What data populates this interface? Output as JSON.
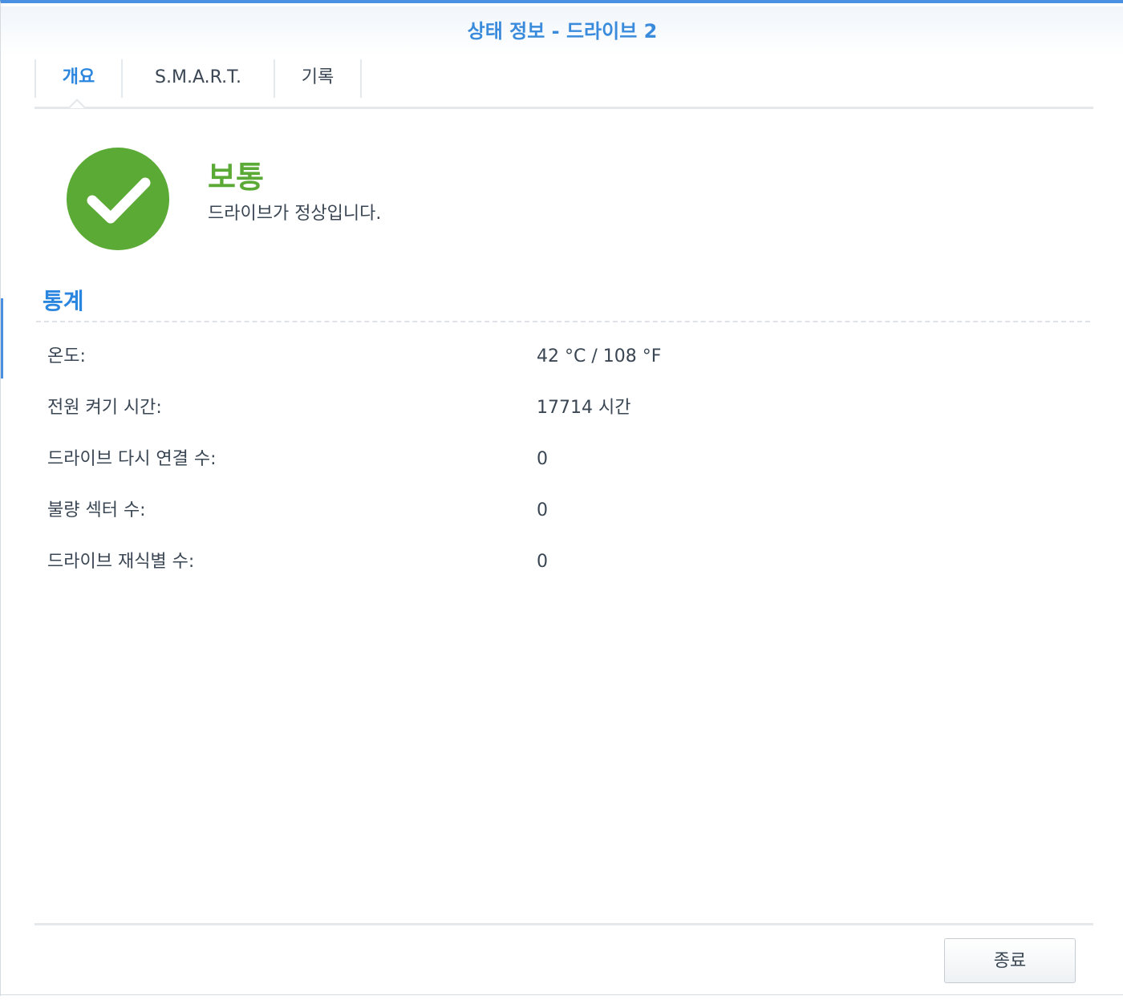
{
  "window": {
    "title": "상태 정보 - 드라이브 2"
  },
  "tabs": [
    {
      "label": "개요",
      "active": true
    },
    {
      "label": "S.M.A.R.T.",
      "active": false
    },
    {
      "label": "기록",
      "active": false
    }
  ],
  "status": {
    "icon": "check-circle-icon",
    "color": "#5aaa35",
    "title": "보통",
    "description": "드라이브가 정상입니다."
  },
  "statistics": {
    "section_title": "통계",
    "rows": [
      {
        "label": "온도:",
        "value": "42 °C / 108 °F"
      },
      {
        "label": "전원 켜기 시간:",
        "value": "17714 시간"
      },
      {
        "label": "드라이브 다시 연결 수:",
        "value": "0"
      },
      {
        "label": "불량 섹터 수:",
        "value": "0"
      },
      {
        "label": "드라이브 재식별 수:",
        "value": "0"
      }
    ]
  },
  "footer": {
    "close_label": "종료"
  },
  "colors": {
    "accent": "#2b86e0",
    "success": "#5aaa35"
  }
}
